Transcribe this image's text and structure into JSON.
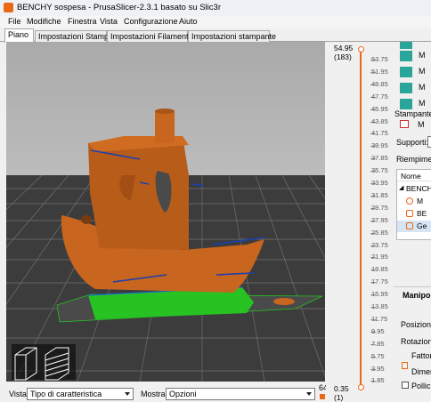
{
  "window": {
    "title": "BENCHY sospesa - PrusaSlicer-2.3.1 basato su Slic3r"
  },
  "menu": [
    "File",
    "Modifiche",
    "Finestra",
    "Vista",
    "Configurazione",
    "Aiuto"
  ],
  "tabs": [
    "Piano",
    "Impostazioni Stampa",
    "Impostazioni Filamento",
    "Impostazioni stampante"
  ],
  "bottom_bar": {
    "view_label": "Vista",
    "view_value": "Tipo di caratteristica",
    "show_label": "Mostra",
    "show_value": "Opzioni",
    "right_value": "64"
  },
  "layer_slider": {
    "top_height": "54.95",
    "top_layer": "(183)",
    "bottom_height": "0.35",
    "bottom_layer": "(1)",
    "ticks": [
      "53.75",
      "51.95",
      "49.85",
      "47.75",
      "45.95",
      "43.85",
      "41.75",
      "39.95",
      "37.85",
      "35.75",
      "33.95",
      "31.85",
      "29.75",
      "27.95",
      "25.85",
      "23.75",
      "21.95",
      "19.85",
      "17.75",
      "15.95",
      "13.85",
      "11.75",
      "9.95",
      "7.85",
      "5.75",
      "3.95",
      "1.85"
    ]
  },
  "sidebar": {
    "rows_label": "M",
    "stampante_label": "Stampante",
    "supporti_label": "Supporti:",
    "riempimento_label": "Riempimen",
    "object_list": {
      "header": "Nome",
      "items": [
        "BENCH",
        "M",
        "BE",
        "Ge"
      ]
    },
    "manipulation": {
      "title": "Manipola",
      "position": "Posizione",
      "rotation": "Rotazione",
      "factor": "Fattor",
      "dimension": "Dimen",
      "inches": "Pollici"
    }
  },
  "colors": {
    "model": "#c8651e",
    "raft": "#26c322",
    "accent": "#e86a17",
    "bed": "#b8b8b8",
    "swatch": "#2aa59b"
  }
}
